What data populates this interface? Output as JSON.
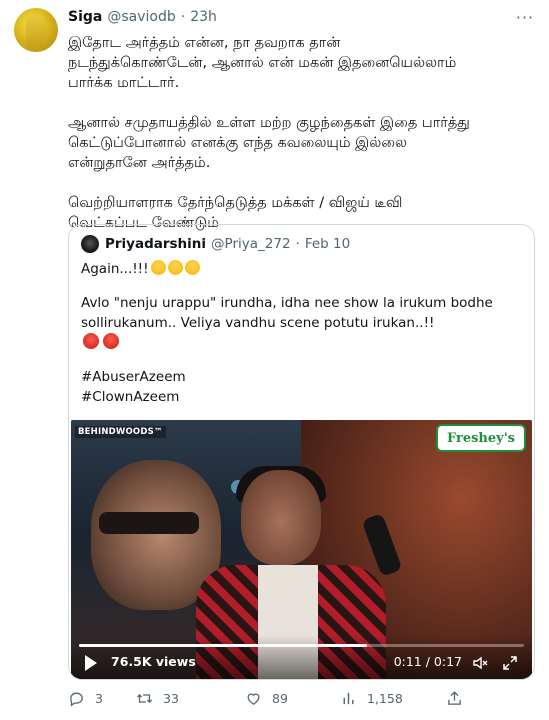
{
  "tweet": {
    "name": "Siga",
    "handle": "@saviodb",
    "separator": "·",
    "time": "23h",
    "paragraphs": [
      "இதோட அர்த்தம் என்ன, நா தவறாக தான்\nநடந்துக்கொண்டேன், ஆனால் என் மகன் இதனையெல்லாம்\nபார்க்க மாட்டார்.",
      "ஆனால் சமுதாயத்தில் உள்ள மற்ற குழந்தைகள் இதை பார்த்து\nகெட்டுப்போனால் எனக்கு எந்த கவலையும் இல்லை\nஎன்றுதானே அர்த்தம்.",
      "வெற்றியாளராக தேர்ந்தெடுத்த மக்கள் / விஜய் டீவி\nவெட்கப்பட வேண்டும்"
    ]
  },
  "quote": {
    "name": "Priyadarshini",
    "handle": "@Priya_272",
    "separator": "·",
    "time": "Feb 10",
    "line1": "Again...!!!",
    "line2": "Avlo \"nenju urappu\" irundha, idha nee show la irukum bodhe",
    "line3": "sollirukanum.. Veliya vandhu scene potutu irukan..!!",
    "hashtag1": "#AbuserAzeem",
    "hashtag2": "#ClownAzeem"
  },
  "video": {
    "watermark": "BEHINDWOODS™",
    "sponsor": "Freshey's",
    "views": "76.5K views",
    "time": "0:11 / 0:17",
    "progress": 0.647
  },
  "actions": {
    "replies": "3",
    "retweets": "33",
    "likes": "89",
    "views": "1,158"
  },
  "colors": {
    "text": "#0f1419",
    "secondary": "#536471",
    "border": "#cfd9de"
  }
}
